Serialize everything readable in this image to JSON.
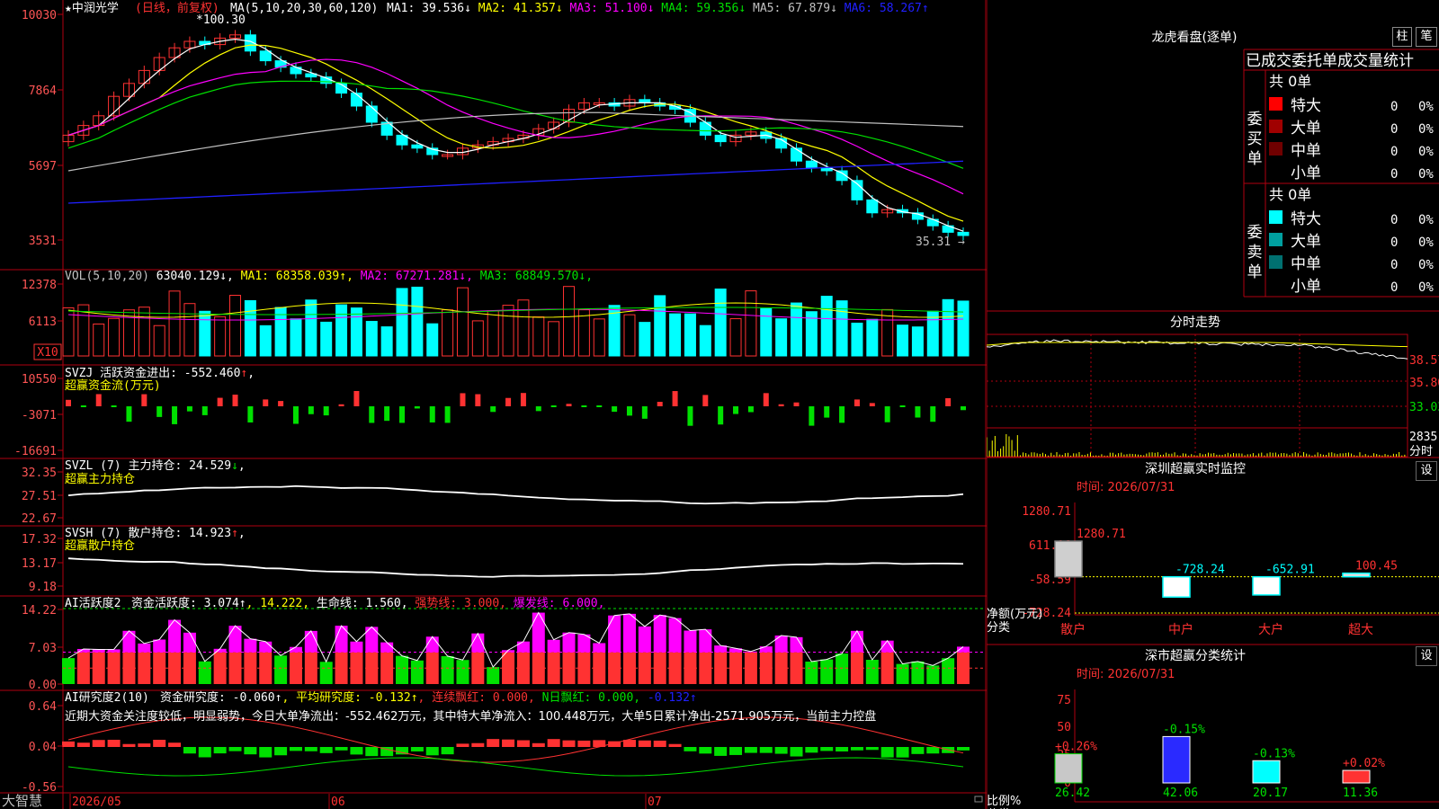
{
  "colors": {
    "up": "#ff3232",
    "down": "#00ffff",
    "bg": "#000000",
    "grid": "#b0000f",
    "axis_text": "#ff5555",
    "green": "#00e000",
    "magenta": "#ff00ff",
    "white": "#ffffff",
    "yellow": "#ffff00",
    "gray": "#a0a0a0",
    "blue": "#2020ff"
  },
  "stock": {
    "name": "中润光学",
    "period": "日线",
    "adjust": "前复权",
    "star": "★"
  },
  "main_panel": {
    "y_ticks": [
      "10030",
      "7864",
      "5697",
      "3531"
    ],
    "ma_label": "MA(5,10,20,30,60,120)",
    "ma_items": [
      {
        "label": "MA1:",
        "value": "39.536",
        "arrow": "↓",
        "color": "#ffffff"
      },
      {
        "label": "MA2:",
        "value": "41.357",
        "arrow": "↓",
        "color": "#ffff00"
      },
      {
        "label": "MA3:",
        "value": "51.100",
        "arrow": "↓",
        "color": "#ff00ff"
      },
      {
        "label": "MA4:",
        "value": "59.356",
        "arrow": "↓",
        "color": "#00e000"
      },
      {
        "label": "MA5:",
        "value": "67.879",
        "arrow": "↓",
        "color": "#c0c0c0"
      },
      {
        "label": "MA6:",
        "value": "58.267",
        "arrow": "↑",
        "color": "#2020ff"
      }
    ],
    "high_label": "100.30",
    "low_label": "35.31"
  },
  "vol_panel": {
    "y_ticks": [
      "12378",
      "6113"
    ],
    "unit": "X10",
    "title": "VOL(5,10,20)",
    "value": "63040.129",
    "arrow": "↓",
    "mas": [
      {
        "label": "MA1:",
        "value": "68358.039",
        "arrow": "↑",
        "color": "#ffff00"
      },
      {
        "label": "MA2:",
        "value": "67271.281",
        "arrow": "↓",
        "color": "#ff00ff"
      },
      {
        "label": "MA3:",
        "value": "68849.570",
        "arrow": "↓",
        "color": "#00e000"
      }
    ]
  },
  "svzj_panel": {
    "y_ticks": [
      "10550",
      "-3071",
      "-16691"
    ],
    "title": "SVZJ",
    "line_label": "活跃资金进出:",
    "value": "-552.460",
    "arrow": "↑",
    "suffix": ",",
    "subtitle": "超赢资金流(万元)"
  },
  "svzl_panel": {
    "y_ticks": [
      "32.35",
      "27.51",
      "22.67"
    ],
    "title": "SVZL (7)",
    "line_label": "主力持仓:",
    "value": "24.529",
    "arrow": "↓",
    "suffix": ",",
    "subtitle": "超赢主力持仓"
  },
  "svsh_panel": {
    "y_ticks": [
      "17.32",
      "13.17",
      "9.18"
    ],
    "title": "SVSH (7)",
    "line_label": "散户持仓:",
    "value": "14.923",
    "arrow": "↑",
    "suffix": ",",
    "subtitle": "超赢散户持仓"
  },
  "ai_active_panel": {
    "y_ticks": [
      "14.22",
      "7.03",
      "0.00"
    ],
    "title": "AI活跃度2",
    "items": [
      {
        "text": "资金活跃度: 3.074",
        "arrow": "↑",
        "color": "#ffffff"
      },
      {
        "text": ", 14.222,",
        "arrow": "",
        "color": "#ffff00"
      },
      {
        "text": " 生命线: 1.560,",
        "arrow": "",
        "color": "#ffffff"
      },
      {
        "text": " 强势线: 3.000,",
        "arrow": "",
        "color": "#ff3232"
      },
      {
        "text": " 爆发线: 6.000,",
        "arrow": "",
        "color": "#ff00ff"
      }
    ]
  },
  "ai_research_panel": {
    "y_ticks": [
      "0.64",
      "0.04",
      "-0.56"
    ],
    "title": "AI研究度2(10)",
    "items": [
      {
        "text": "资金研究度: -0.060",
        "arrow": "↑",
        "color": "#ffffff"
      },
      {
        "text": ", 平均研究度: -0.132",
        "arrow": "↑",
        "color": "#ffff00"
      },
      {
        "text": ", 连续飘红: 0.000,",
        "arrow": "",
        "color": "#ff3232"
      },
      {
        "text": " N日飘红: 0.000,",
        "arrow": "",
        "color": "#00e000"
      },
      {
        "text": " -0.132",
        "arrow": "↑",
        "color": "#2020ff"
      }
    ],
    "comment": "近期大资金关注度较低，明显弱势，今日大单净流出：-552.462万元，其中特大单净流入：100.448万元，大单5日累计净出-2571.905万元，当前主力控盘"
  },
  "bottom_axis": {
    "brand": "大智慧",
    "dates": [
      "2026/05",
      "06",
      "07"
    ]
  },
  "lhb": {
    "title": "龙虎看盘(逐单)",
    "tab1": "柱",
    "tab2": "笔",
    "header": "已成交委托单成交量统计",
    "buy": {
      "side": "委买单",
      "total": "共 0单",
      "rows": [
        {
          "name": "特大",
          "count": "0",
          "pct": "0%",
          "color": "#ff0000"
        },
        {
          "name": "大单",
          "count": "0",
          "pct": "0%",
          "color": "#a00000"
        },
        {
          "name": "中单",
          "count": "0",
          "pct": "0%",
          "color": "#700000"
        },
        {
          "name": "小单",
          "count": "0",
          "pct": "0%",
          "color": "#000000"
        }
      ]
    },
    "sell": {
      "side": "委卖单",
      "total": "共 0单",
      "rows": [
        {
          "name": "特大",
          "count": "0",
          "pct": "0%",
          "color": "#00ffff"
        },
        {
          "name": "大单",
          "count": "0",
          "pct": "0%",
          "color": "#00a0a0"
        },
        {
          "name": "中单",
          "count": "0",
          "pct": "0%",
          "color": "#007070"
        },
        {
          "name": "小单",
          "count": "0",
          "pct": "0%",
          "color": "#000000"
        }
      ]
    }
  },
  "intraday": {
    "title": "分时走势",
    "y_ticks": [
      "38.57",
      "35.80",
      "33.03"
    ],
    "vol_tick": "2835",
    "vol_unit": "分时"
  },
  "sz_monitor": {
    "title": "深圳超赢实时监控",
    "set": "设",
    "time_label": "时间: 2026/07/31",
    "y_ticks": [
      "1280.71",
      "611.06",
      "-58.59",
      "-728.24"
    ],
    "ylabel": "净额(万元)",
    "xlabel": "分类",
    "categories": [
      "散户",
      "中户",
      "大户",
      "超大"
    ],
    "values": [
      1280.71,
      -728.24,
      -652.91,
      100.45
    ],
    "value_labels": [
      "1280.71",
      "-728.24",
      "-652.91",
      "100.45"
    ]
  },
  "sz_class": {
    "title": "深市超赢分类统计",
    "set": "设",
    "time_label": "时间: 2026/07/31",
    "y_ticks": [
      "75",
      "50",
      "25",
      "0"
    ],
    "ylabel": "比例%",
    "xlabel": "分类",
    "categories": [
      "散户",
      "中户",
      "大户",
      "超大"
    ],
    "values": [
      26.42,
      42.06,
      20.17,
      11.36
    ],
    "value_labels": [
      "26.42",
      "42.06",
      "20.17",
      "11.36"
    ],
    "changes": [
      "+0.26%",
      "-0.15%",
      "-0.13%",
      "+0.02%"
    ]
  },
  "chart_data": [
    {
      "type": "candlestick",
      "title": "中润光学 日线 前复权",
      "y_ticks": [
        "10030",
        "7864",
        "5697",
        "3531"
      ],
      "x_labels": [
        "2026/05",
        "06",
        "07"
      ],
      "high_label": "100.30",
      "low_label": "35.31",
      "ma": {
        "MA1": 39.536,
        "MA2": 41.357,
        "MA3": 51.1,
        "MA4": 59.356,
        "MA5": 67.879,
        "MA6": 58.267
      }
    },
    {
      "type": "bar",
      "title": "VOL(5,10,20)",
      "latest": 63040.129,
      "ma": {
        "MA1": 68358.039,
        "MA2": 67271.281,
        "MA3": 68849.57
      }
    },
    {
      "type": "bar",
      "title": "SVZJ",
      "latest": -552.46
    },
    {
      "type": "line",
      "title": "SVZL (7)",
      "latest": 24.529
    },
    {
      "type": "line",
      "title": "SVSH (7)",
      "latest": 14.923
    },
    {
      "type": "bar",
      "title": "AI活跃度2",
      "latest": 3.074
    },
    {
      "type": "bar",
      "title": "AI研究度2(10)",
      "latest": -0.06
    },
    {
      "type": "bar",
      "title": "深圳超赢实时监控",
      "categories": [
        "散户",
        "中户",
        "大户",
        "超大"
      ],
      "values": [
        1280.71,
        -728.24,
        -652.91,
        100.45
      ]
    },
    {
      "type": "bar",
      "title": "深市超赢分类统计",
      "categories": [
        "散户",
        "中户",
        "大户",
        "超大"
      ],
      "values": [
        26.42,
        42.06,
        20.17,
        11.36
      ],
      "ylim": [
        0,
        75
      ]
    }
  ]
}
